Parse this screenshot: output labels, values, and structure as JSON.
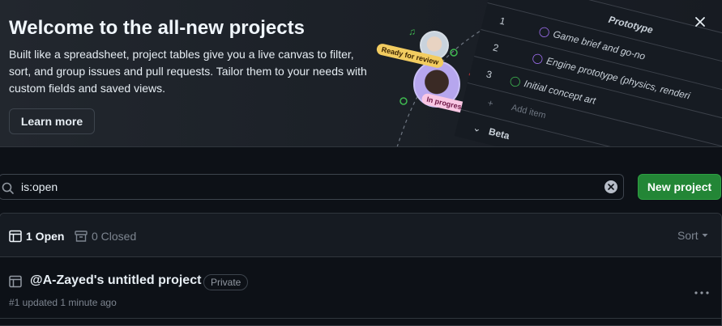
{
  "banner": {
    "title": "Welcome to the all-new projects",
    "description": "Built like a spreadsheet, project tables give you a live canvas to filter, sort, and group issues and pull requests. Tailor them to your needs with custom fields and saved views.",
    "learn_more_label": "Learn more",
    "close_icon": "close-icon",
    "illustration": {
      "pill_review": "Ready for review",
      "pill_progress": "In progress",
      "group_header": "Prototype",
      "rows": [
        {
          "num": "1",
          "label": "Game brief and go-no"
        },
        {
          "num": "2",
          "label": "Engine prototype (physics, renderi"
        },
        {
          "num": "3",
          "label": "Initial concept art"
        }
      ],
      "add_item": "Add item",
      "next_group": "Beta"
    }
  },
  "search": {
    "value": "is:open",
    "icon": "search-icon",
    "clear_icon": "clear-icon"
  },
  "new_project_label": "New project",
  "list": {
    "tabs": {
      "open_label": "1 Open",
      "closed_label": "0 Closed"
    },
    "sort_label": "Sort",
    "projects": [
      {
        "title": "@A-Zayed's untitled project",
        "visibility": "Private",
        "meta": "#1 updated 1 minute ago"
      }
    ]
  },
  "colors": {
    "background": "#0d1117",
    "accent_green": "#238636",
    "border": "#30363d"
  }
}
